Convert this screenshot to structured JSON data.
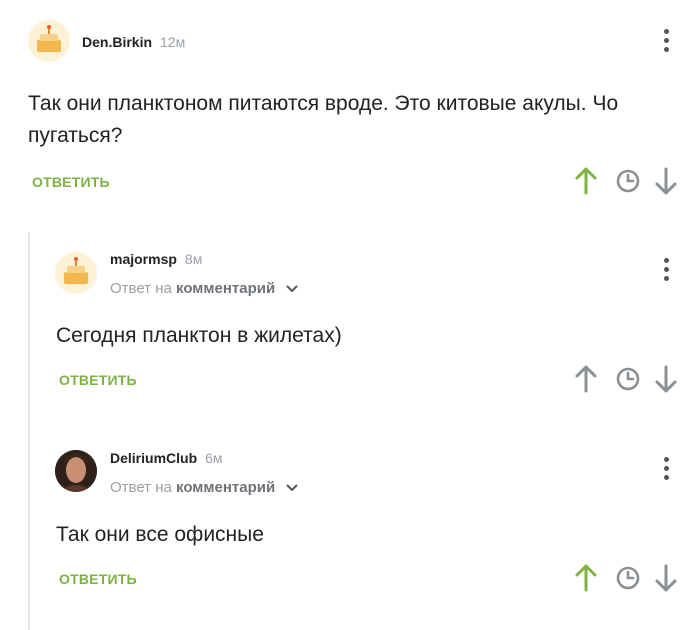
{
  "comments": [
    {
      "author": "Den.Birkin",
      "time": "12м",
      "text_lines": [
        "Так они планктоном питаются вроде. Это китовые акулы. Чо",
        "пугаться?"
      ],
      "reply_label": "ОТВЕТИТЬ",
      "upvoted": true
    },
    {
      "author": "majormsp",
      "time": "8м",
      "reply_prefix": "Ответ на",
      "reply_target": "комментарий",
      "text": "Сегодня планктон в жилетах)",
      "reply_label": "ОТВЕТИТЬ",
      "upvoted": false
    },
    {
      "author": "DeliriumClub",
      "time": "6м",
      "reply_prefix": "Ответ на",
      "reply_target": "комментарий",
      "text": "Так они все офисные",
      "reply_label": "ОТВЕТИТЬ",
      "upvoted": true
    }
  ],
  "icons": {
    "upvote": "arrow-up-icon",
    "save": "clock-icon",
    "downvote": "arrow-down-icon",
    "menu": "more-vertical-icon"
  },
  "colors": {
    "accent_green": "#7cb342",
    "vote_gray": "#8a8f94"
  }
}
